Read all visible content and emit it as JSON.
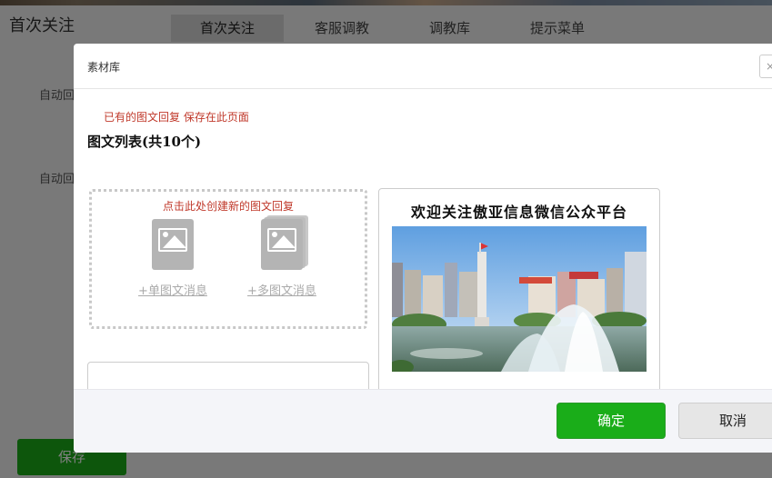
{
  "page": {
    "title": "首次关注",
    "tabs": [
      {
        "label": "首次关注",
        "active": true
      },
      {
        "label": "客服调教",
        "active": false
      },
      {
        "label": "调教库",
        "active": false
      },
      {
        "label": "提示菜单",
        "active": false
      }
    ],
    "auto_label_1": "自动回",
    "auto_label_2": "自动回",
    "save_label": "保存"
  },
  "dialog": {
    "title": "素材库",
    "close_glyph": "×",
    "hint": "已有的图文回复 保存在此页面",
    "list_title": "图文列表(共10个)",
    "create": {
      "hint": "点击此处创建新的图文回复",
      "single_label": "+单图文消息",
      "multi_label": "+多图文消息"
    },
    "news": {
      "title": "欢迎关注傲亚信息微信公众平台"
    },
    "ok_label": "确定",
    "cancel_label": "取消"
  },
  "colors": {
    "primary_green": "#1aad19",
    "hint_red": "#c0392b"
  }
}
